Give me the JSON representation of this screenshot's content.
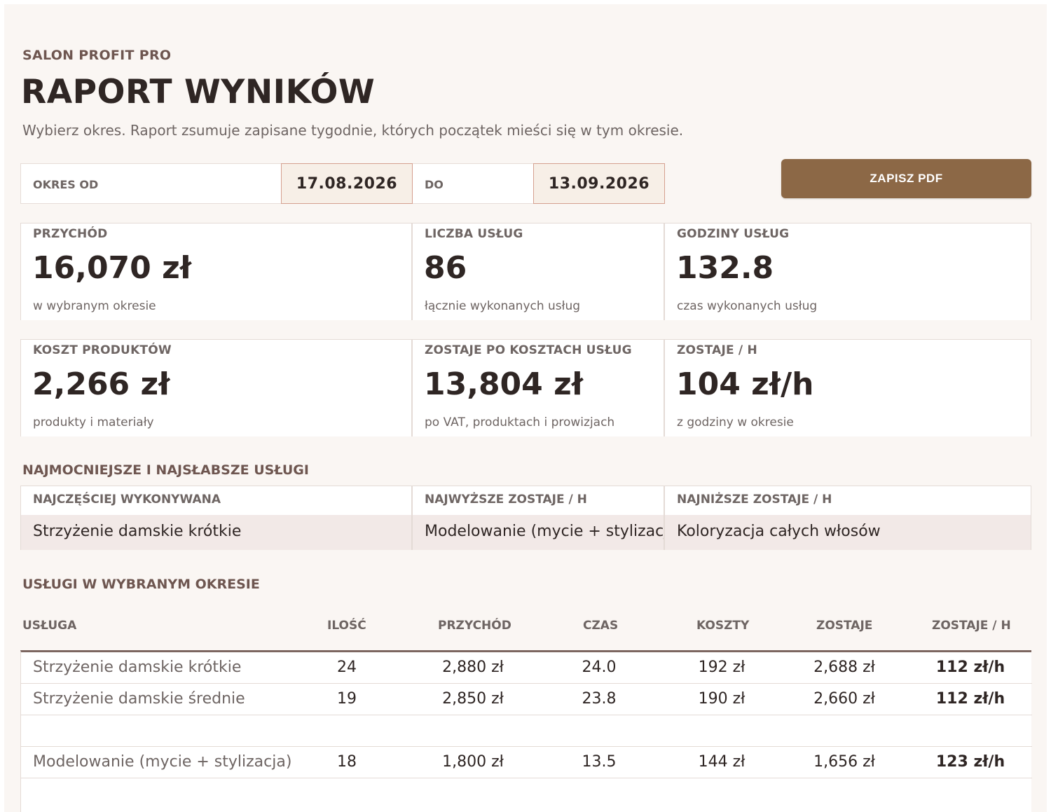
{
  "header": {
    "brand": "SALON PROFIT PRO",
    "title": "RAPORT WYNIKÓW",
    "subtitle": "Wybierz okres. Raport zsumuje zapisane tygodnie, których początek mieści się w tym okresie."
  },
  "period": {
    "from_label": "OKRES OD",
    "from_value": "17.08.2026",
    "to_label": "DO",
    "to_value": "13.09.2026"
  },
  "actions": {
    "save_pdf": "ZAPISZ PDF",
    "accent": "#8c6846"
  },
  "kpis_top": [
    {
      "label": "PRZYCHÓD",
      "value": "16,070 zł",
      "note": "w wybranym okresie"
    },
    {
      "label": "LICZBA USŁUG",
      "value": "86",
      "note": "łącznie wykonanych usług"
    },
    {
      "label": "GODZINY USŁUG",
      "value": "132.8",
      "note": "czas wykonanych usług"
    }
  ],
  "kpis_bottom": [
    {
      "label": "KOSZT PRODUKTÓW",
      "value": "2,266 zł",
      "note": "produkty i materiały"
    },
    {
      "label": "ZOSTAJE PO KOSZTACH USŁUG",
      "value": "13,804 zł",
      "note": "po VAT, produktach i prowizjach"
    },
    {
      "label": "ZOSTAJE / H",
      "value": "104 zł/h",
      "note": "z godziny w okresie"
    }
  ],
  "best_worst": {
    "heading": "NAJMOCNIEJSZE I NAJSŁABSZE USŁUGI",
    "items": [
      {
        "label": "NAJCZĘŚCIEJ WYKONYWANA",
        "value": "Strzyżenie damskie krótkie"
      },
      {
        "label": "NAJWYŻSZE ZOSTAJE / H",
        "value": "Modelowanie (mycie + stylizacja)"
      },
      {
        "label": "NAJNIŻSZE ZOSTAJE / H",
        "value": "Koloryzacja całych włosów"
      }
    ]
  },
  "services": {
    "heading": "USŁUGI W WYBRANYM OKRESIE",
    "columns": [
      "USŁUGA",
      "ILOŚĆ",
      "PRZYCHÓD",
      "CZAS",
      "KOSZTY",
      "ZOSTAJE",
      "ZOSTAJE / H"
    ],
    "rows": [
      {
        "name": "Strzyżenie damskie krótkie",
        "qty": "24",
        "revenue": "2,880 zł",
        "time": "24.0",
        "costs": "192 zł",
        "net": "2,688 zł",
        "per_hour": "112 zł/h"
      },
      {
        "name": "Strzyżenie damskie średnie",
        "qty": "19",
        "revenue": "2,850 zł",
        "time": "23.8",
        "costs": "190 zł",
        "net": "2,660 zł",
        "per_hour": "112 zł/h"
      },
      {
        "name": "",
        "qty": "",
        "revenue": "",
        "time": "",
        "costs": "",
        "net": "",
        "per_hour": ""
      },
      {
        "name": "Modelowanie (mycie + stylizacja)",
        "qty": "18",
        "revenue": "1,800 zł",
        "time": "13.5",
        "costs": "144 zł",
        "net": "1,656 zł",
        "per_hour": "123 zł/h"
      }
    ]
  }
}
